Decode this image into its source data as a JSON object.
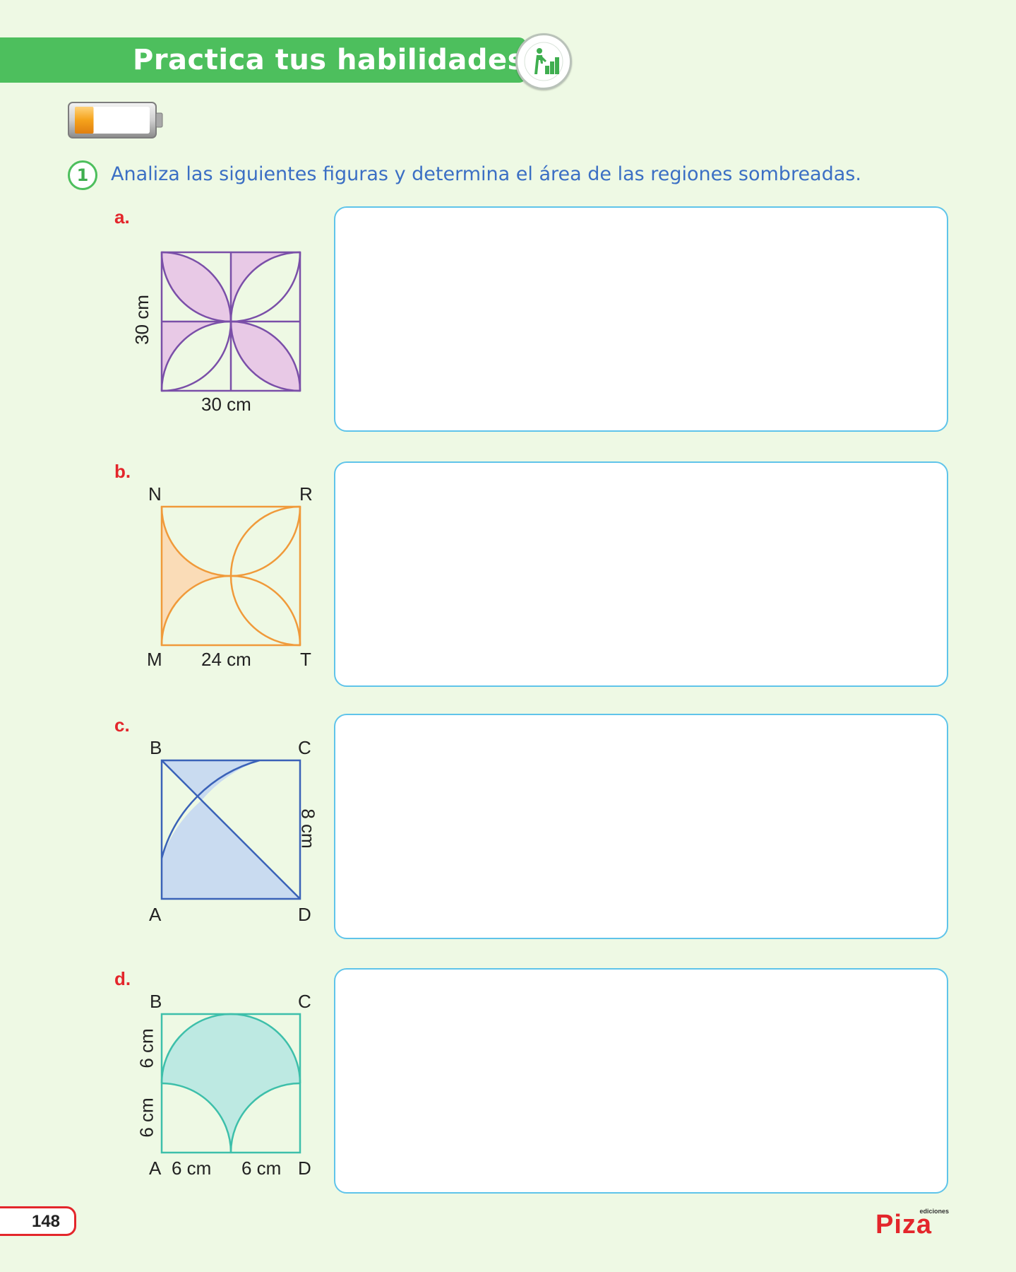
{
  "header": {
    "title": "Practica tus habilidades",
    "badge_icon": "climbing-steps-icon"
  },
  "level_indicator": {
    "icon": "battery-icon",
    "fill_fraction": 0.25,
    "fill_color": "#f5a21b"
  },
  "question": {
    "number": "1",
    "text": "Analiza las siguientes figuras y determina el área de las regiones sombreadas."
  },
  "items": [
    {
      "label": "a.",
      "side_label": "30 cm",
      "bottom_label": "30 cm",
      "color": "#7a4fa8",
      "fill": "#e8c9e6"
    },
    {
      "label": "b.",
      "vertices": {
        "top_left": "N",
        "top_right": "R",
        "bottom_left": "M",
        "bottom_right": "T"
      },
      "bottom_label": "24 cm",
      "color": "#f09a3a",
      "fill": "#fadcb7"
    },
    {
      "label": "c.",
      "vertices": {
        "top_left": "B",
        "top_right": "C",
        "bottom_left": "A",
        "bottom_right": "D"
      },
      "side_label": "8 cm",
      "color": "#3a62b8",
      "fill": "#c9dbf0"
    },
    {
      "label": "d.",
      "vertices": {
        "top_left": "B",
        "top_right": "C",
        "bottom_left": "A",
        "bottom_right": "D"
      },
      "side_label_upper": "6 cm",
      "side_label_lower": "6 cm",
      "bottom_label_left": "6 cm",
      "bottom_label_right": "6 cm",
      "color": "#3dbfaa",
      "fill": "#bde9e2"
    }
  ],
  "footer": {
    "page_number": "148",
    "logo_small": "ediciones",
    "logo_main": "Piza"
  }
}
